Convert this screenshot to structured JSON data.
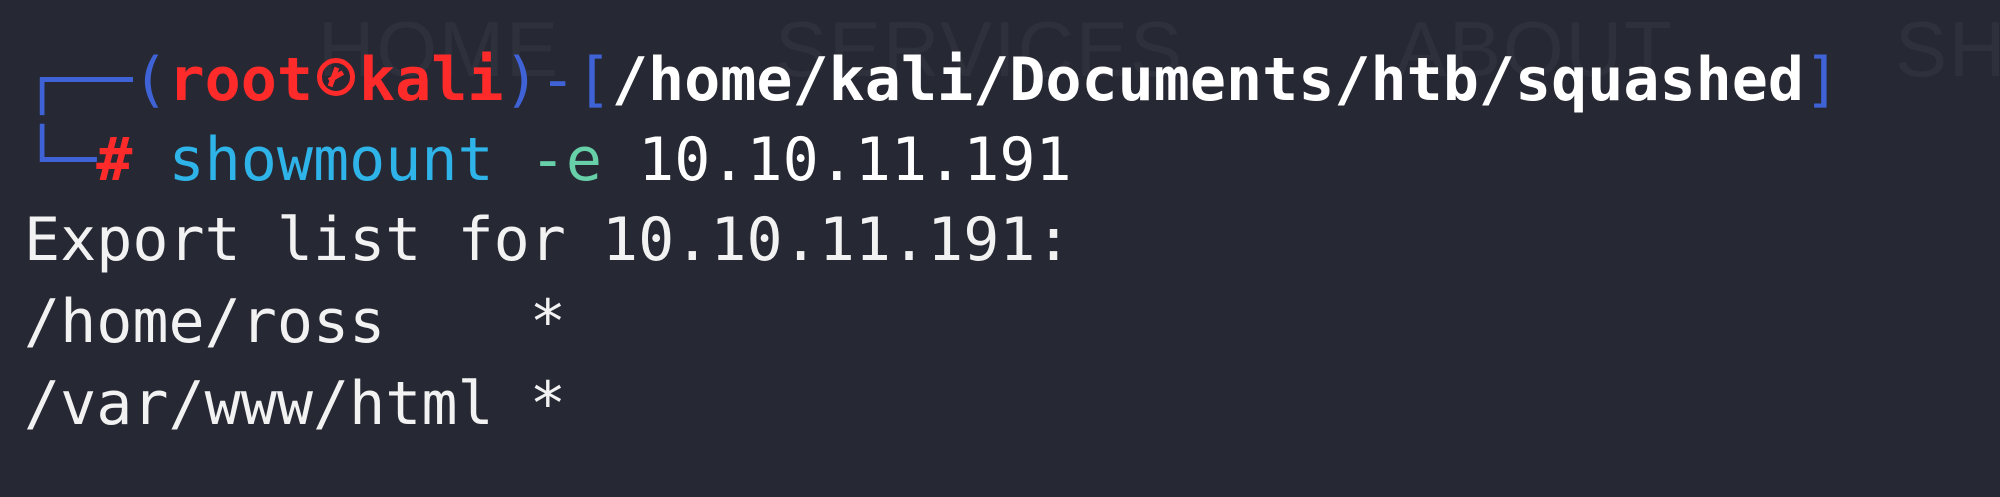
{
  "background_nav": {
    "items": [
      "HOME",
      "SERVICES",
      "ABOUT",
      "SH"
    ]
  },
  "prompt": {
    "user": "root",
    "host": "kali",
    "cwd": "/home/kali/Documents/htb/squashed",
    "symbol": "#"
  },
  "command": {
    "program": "showmount",
    "flag": "-e",
    "argument": "10.10.11.191"
  },
  "output": {
    "header": "Export list for 10.10.11.191:",
    "exports": [
      {
        "path": "/home/ross",
        "clients": "*"
      },
      {
        "path": "/var/www/html",
        "clients": "*"
      }
    ]
  },
  "colors": {
    "background": "#262934",
    "prompt_box": "#3f63d6",
    "prompt_red": "#ff2a2a",
    "command": "#2fb4e9",
    "flag": "#67d0a8"
  }
}
